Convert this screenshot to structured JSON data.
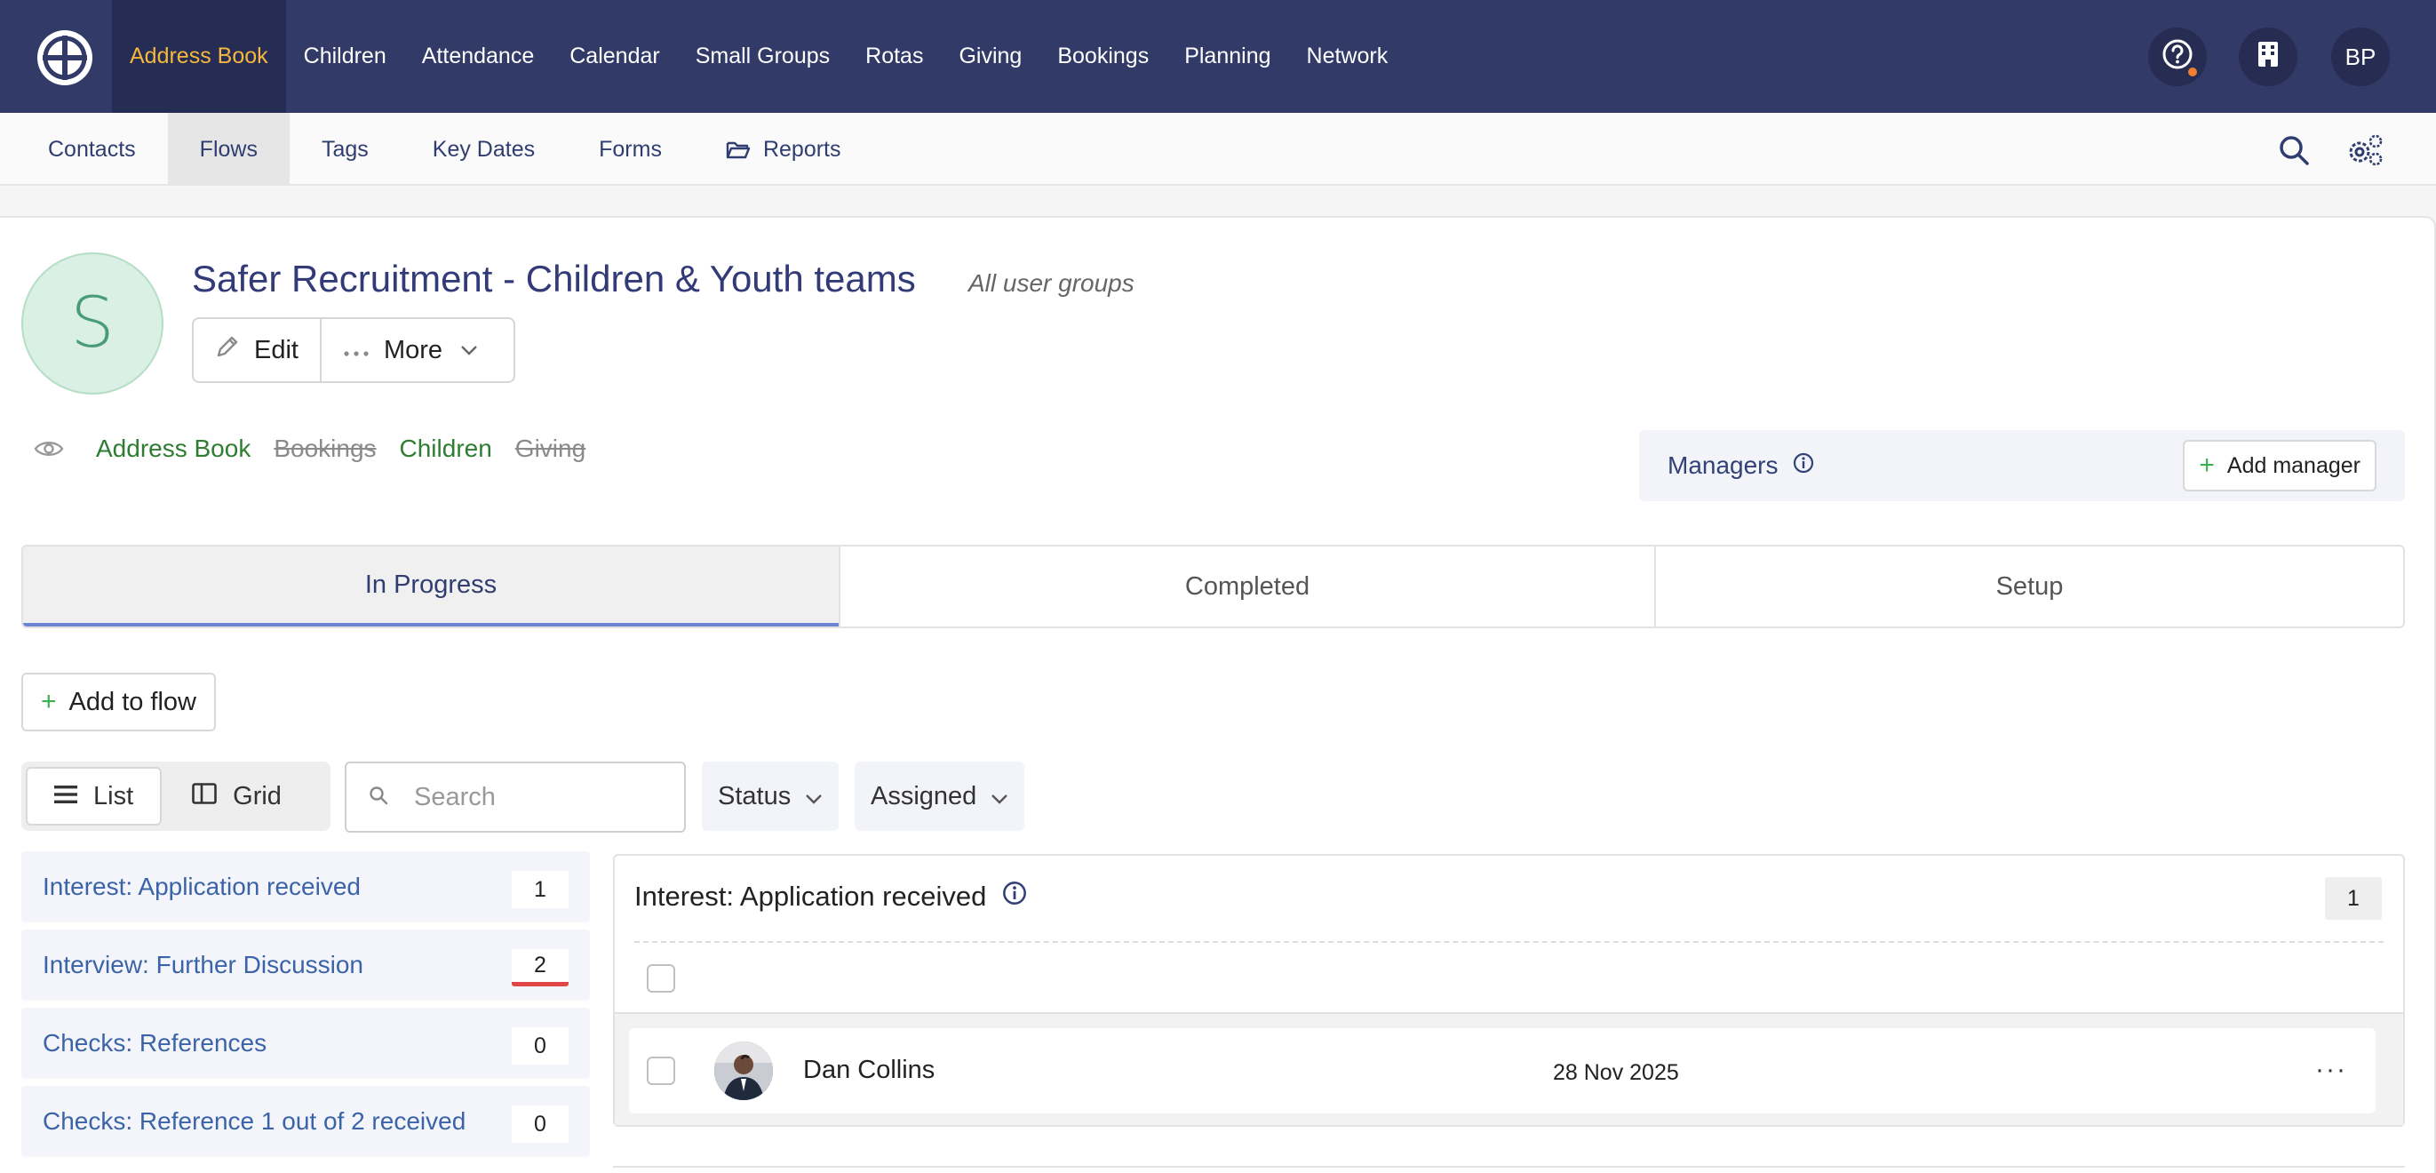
{
  "topnav": {
    "items": [
      {
        "label": "Address Book",
        "active": true
      },
      {
        "label": "Children"
      },
      {
        "label": "Attendance"
      },
      {
        "label": "Calendar"
      },
      {
        "label": "Small Groups"
      },
      {
        "label": "Rotas"
      },
      {
        "label": "Giving"
      },
      {
        "label": "Bookings"
      },
      {
        "label": "Planning"
      },
      {
        "label": "Network"
      }
    ],
    "help_icon": "question-circle-icon",
    "building_icon": "building-icon",
    "user_initials": "BP",
    "active_color": "#f6b73c",
    "bar_color": "#323a68"
  },
  "subnav": {
    "items": [
      {
        "label": "Contacts"
      },
      {
        "label": "Flows",
        "active": true
      },
      {
        "label": "Tags"
      },
      {
        "label": "Key Dates"
      },
      {
        "label": "Forms"
      },
      {
        "label": "Reports",
        "icon": "folder-open-icon"
      }
    ],
    "search_icon": "search-icon",
    "settings_icon": "gears-icon"
  },
  "flow": {
    "avatar_letter": "S",
    "title": "Safer Recruitment - Children & Youth teams",
    "subtitle": "All user groups",
    "edit_label": "Edit",
    "more_label": "More",
    "visibility_icon": "eye-icon",
    "modules": [
      {
        "label": "Address Book",
        "enabled": true
      },
      {
        "label": "Bookings",
        "enabled": false
      },
      {
        "label": "Children",
        "enabled": true
      },
      {
        "label": "Giving",
        "enabled": false
      }
    ]
  },
  "managers": {
    "label": "Managers",
    "add_label": "Add manager"
  },
  "tabs": [
    {
      "label": "In Progress",
      "active": true
    },
    {
      "label": "Completed"
    },
    {
      "label": "Setup"
    }
  ],
  "toolbar": {
    "add_to_flow_label": "Add to flow",
    "list_label": "List",
    "grid_label": "Grid",
    "search_placeholder": "Search",
    "status_label": "Status",
    "assigned_label": "Assigned"
  },
  "stages": [
    {
      "label": "Interest: Application received",
      "count": "1"
    },
    {
      "label": "Interview: Further Discussion",
      "count": "2",
      "alert": true
    },
    {
      "label": "Checks: References",
      "count": "0"
    },
    {
      "label": "Checks: Reference 1 out of 2 received",
      "count": "0"
    }
  ],
  "detail": {
    "title": "Interest: Application received",
    "count": "1",
    "rows": [
      {
        "name": "Dan Collins",
        "date": "28 Nov 2025"
      }
    ],
    "row_menu": "···"
  }
}
